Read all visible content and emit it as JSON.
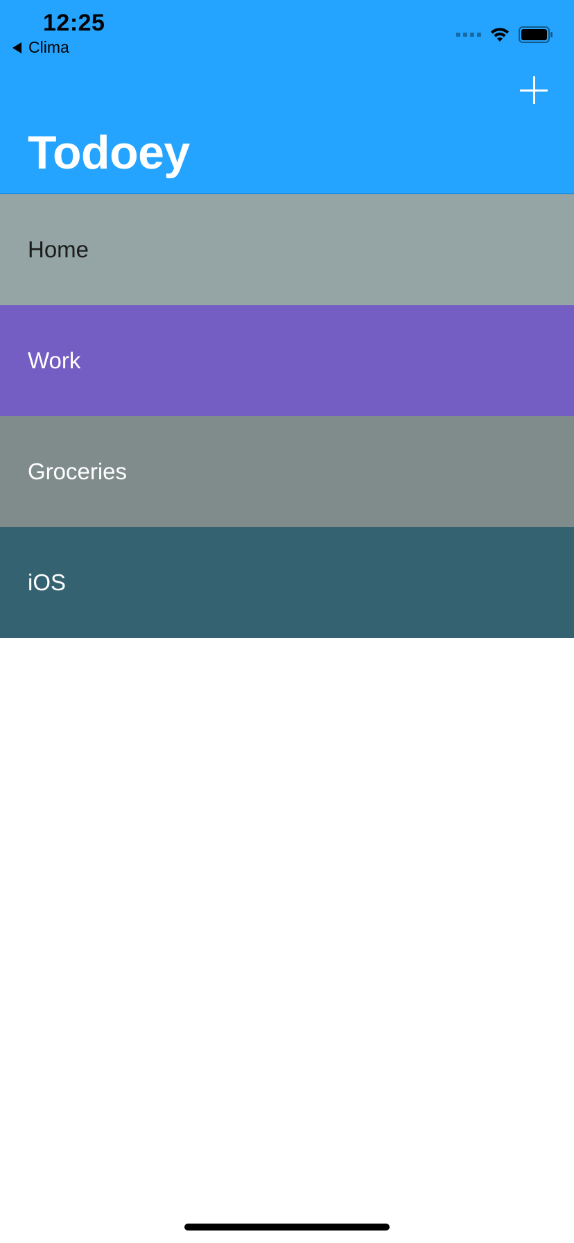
{
  "status_bar": {
    "time": "12:25",
    "back_label": "Clima",
    "signal_icon": "signal-dots-icon",
    "wifi_icon": "wifi-icon",
    "battery_icon": "battery-icon"
  },
  "navbar": {
    "title": "Todoey",
    "add_icon": "plus-icon",
    "background_color": "#24A4FE"
  },
  "categories": [
    {
      "label": "Home",
      "background_color": "#95A5A5",
      "text_color": "#1C1C1C"
    },
    {
      "label": "Work",
      "background_color": "#745EC3",
      "text_color": "#FFFFFF"
    },
    {
      "label": "Groceries",
      "background_color": "#7F8C8B",
      "text_color": "#FFFFFF"
    },
    {
      "label": "iOS",
      "background_color": "#346270",
      "text_color": "#FFFFFF"
    }
  ]
}
